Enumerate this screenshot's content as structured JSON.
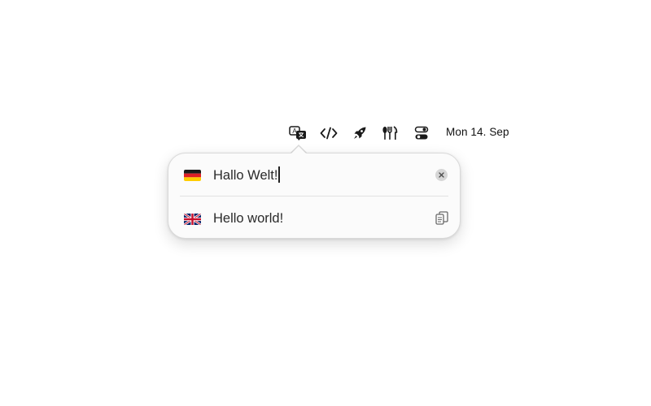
{
  "menubar": {
    "icons": [
      "translate-icon",
      "code-icon",
      "rocket-icon",
      "utensils-icon",
      "toggle-icon"
    ],
    "date": "Mon 14. Sep"
  },
  "translator": {
    "source": {
      "language_flag": "german-flag",
      "text": "Hallo Welt!"
    },
    "target": {
      "language_flag": "uk-flag",
      "text": "Hello world!"
    }
  }
}
